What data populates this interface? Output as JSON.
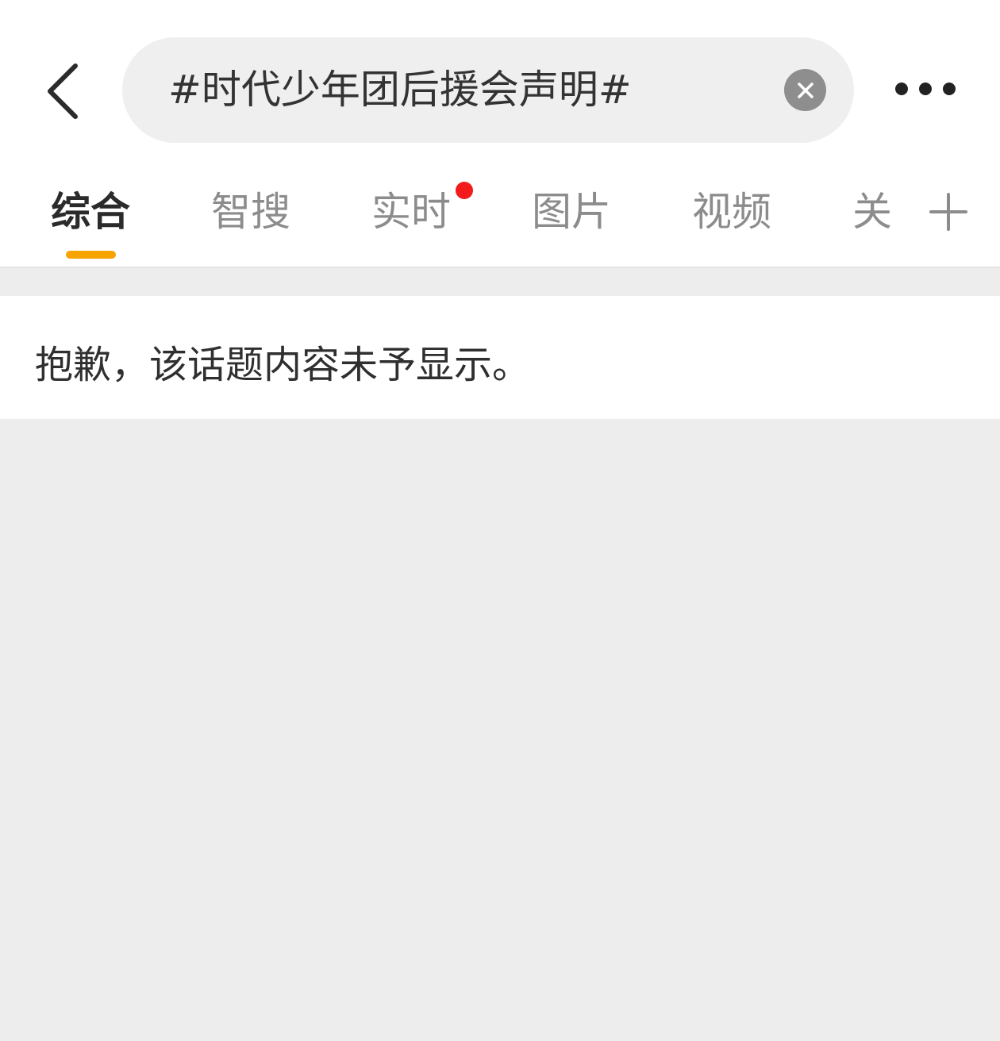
{
  "search": {
    "query": "#时代少年团后援会声明#"
  },
  "tabs": [
    {
      "label": "综合",
      "active": true
    },
    {
      "label": "智搜",
      "active": false
    },
    {
      "label": "实时",
      "active": false,
      "has_red_dot": true
    },
    {
      "label": "图片",
      "active": false
    },
    {
      "label": "视频",
      "active": false
    },
    {
      "label": "关",
      "active": false
    }
  ],
  "notice": {
    "message": "抱歉，该话题内容未予显示。"
  },
  "colors": {
    "accent_indicator": "#f7a300",
    "red_dot": "#f21a1a",
    "page_background": "#ededed",
    "search_box_background": "#efefef"
  },
  "icons": {
    "back": "back-chevron-icon",
    "clear": "clear-x-icon",
    "more": "more-dots-icon",
    "add_tab": "plus-icon"
  }
}
